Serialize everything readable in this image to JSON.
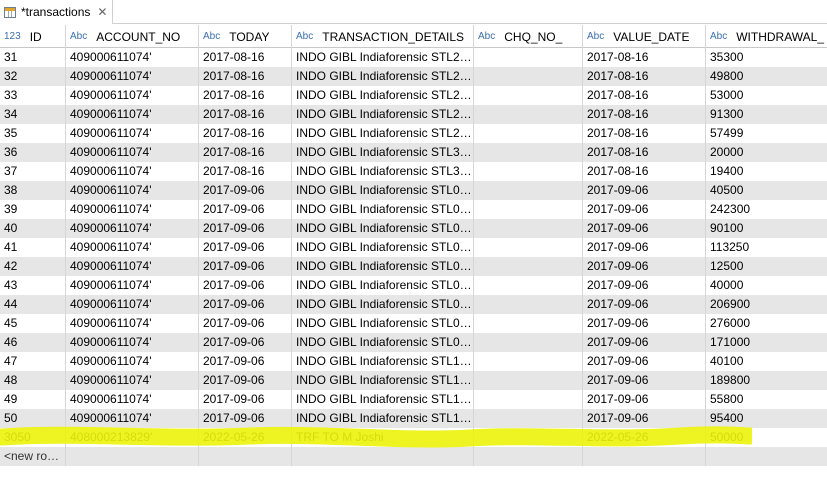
{
  "tab": {
    "title": "*transactions",
    "icon": "table-icon",
    "close_icon": "close-icon"
  },
  "columns": [
    {
      "type": "123",
      "name": "ID"
    },
    {
      "type": "Abc",
      "name": "ACCOUNT_NO"
    },
    {
      "type": "Abc",
      "name": "TODAY"
    },
    {
      "type": "Abc",
      "name": "TRANSACTION_DETAILS"
    },
    {
      "type": "Abc",
      "name": "CHQ_NO_"
    },
    {
      "type": "Abc",
      "name": "VALUE_DATE"
    },
    {
      "type": "Abc",
      "name": "WITHDRAWAL_"
    }
  ],
  "rows": [
    [
      "31",
      "409000611074'",
      "2017-08-16",
      "INDO GIBL Indiaforensic STL2…",
      "",
      "2017-08-16",
      "35300"
    ],
    [
      "32",
      "409000611074'",
      "2017-08-16",
      "INDO GIBL Indiaforensic STL2…",
      "",
      "2017-08-16",
      "49800"
    ],
    [
      "33",
      "409000611074'",
      "2017-08-16",
      "INDO GIBL Indiaforensic STL2…",
      "",
      "2017-08-16",
      "53000"
    ],
    [
      "34",
      "409000611074'",
      "2017-08-16",
      "INDO GIBL Indiaforensic STL2…",
      "",
      "2017-08-16",
      "91300"
    ],
    [
      "35",
      "409000611074'",
      "2017-08-16",
      "INDO GIBL Indiaforensic STL2…",
      "",
      "2017-08-16",
      "57499"
    ],
    [
      "36",
      "409000611074'",
      "2017-08-16",
      "INDO GIBL Indiaforensic STL3…",
      "",
      "2017-08-16",
      "20000"
    ],
    [
      "37",
      "409000611074'",
      "2017-08-16",
      "INDO GIBL Indiaforensic STL3…",
      "",
      "2017-08-16",
      "19400"
    ],
    [
      "38",
      "409000611074'",
      "2017-09-06",
      "INDO GIBL Indiaforensic STL0…",
      "",
      "2017-09-06",
      "40500"
    ],
    [
      "39",
      "409000611074'",
      "2017-09-06",
      "INDO GIBL Indiaforensic STL0…",
      "",
      "2017-09-06",
      "242300"
    ],
    [
      "40",
      "409000611074'",
      "2017-09-06",
      "INDO GIBL Indiaforensic STL0…",
      "",
      "2017-09-06",
      "90100"
    ],
    [
      "41",
      "409000611074'",
      "2017-09-06",
      "INDO GIBL Indiaforensic STL0…",
      "",
      "2017-09-06",
      "113250"
    ],
    [
      "42",
      "409000611074'",
      "2017-09-06",
      "INDO GIBL Indiaforensic STL0…",
      "",
      "2017-09-06",
      "12500"
    ],
    [
      "43",
      "409000611074'",
      "2017-09-06",
      "INDO GIBL Indiaforensic STL0…",
      "",
      "2017-09-06",
      "40000"
    ],
    [
      "44",
      "409000611074'",
      "2017-09-06",
      "INDO GIBL Indiaforensic STL0…",
      "",
      "2017-09-06",
      "206900"
    ],
    [
      "45",
      "409000611074'",
      "2017-09-06",
      "INDO GIBL Indiaforensic STL0…",
      "",
      "2017-09-06",
      "276000"
    ],
    [
      "46",
      "409000611074'",
      "2017-09-06",
      "INDO GIBL Indiaforensic STL0…",
      "",
      "2017-09-06",
      "171000"
    ],
    [
      "47",
      "409000611074'",
      "2017-09-06",
      "INDO GIBL Indiaforensic STL1…",
      "",
      "2017-09-06",
      "40100"
    ],
    [
      "48",
      "409000611074'",
      "2017-09-06",
      "INDO GIBL Indiaforensic STL1…",
      "",
      "2017-09-06",
      "189800"
    ],
    [
      "49",
      "409000611074'",
      "2017-09-06",
      "INDO GIBL Indiaforensic STL1…",
      "",
      "2017-09-06",
      "55800"
    ],
    [
      "50",
      "409000611074'",
      "2017-09-06",
      "INDO GIBL Indiaforensic STL1…",
      "",
      "2017-09-06",
      "95400"
    ],
    [
      "3050",
      "408000213829'",
      "2022-05-26",
      "TRF TO  M Joshi",
      "",
      "2022-05-26",
      "50000"
    ]
  ],
  "new_row_label": "<new ro…",
  "colors": {
    "alt_row": "#e6e6e6",
    "highlight": "#ecf20a",
    "type_label": "#3a6fb0",
    "tab_icon": "#e0a52b"
  }
}
